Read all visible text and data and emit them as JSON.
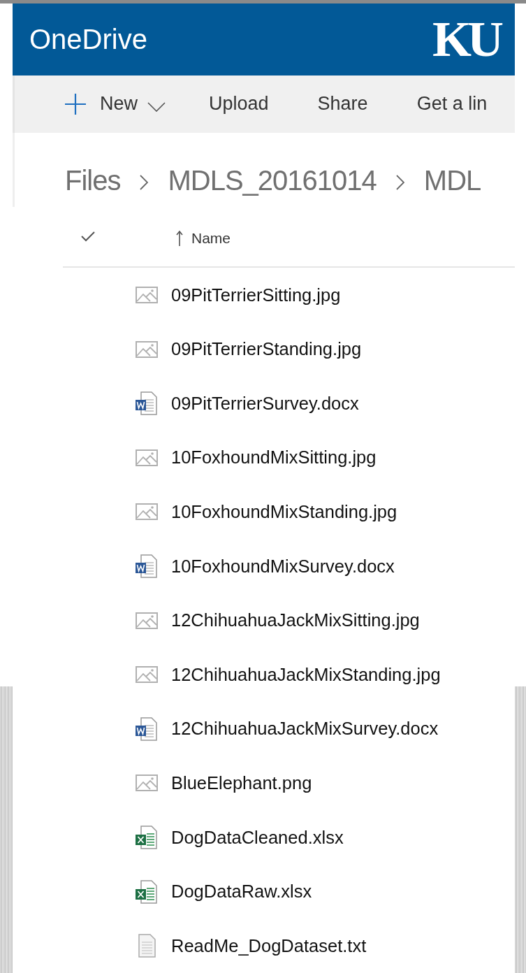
{
  "header": {
    "title": "OneDrive",
    "logo": "KU"
  },
  "toolbar": [
    {
      "kind": "new",
      "label": "New"
    },
    {
      "kind": "plain",
      "label": "Upload"
    },
    {
      "kind": "plain",
      "label": "Share"
    },
    {
      "kind": "plain",
      "label": "Get a lin"
    }
  ],
  "breadcrumb": [
    "Files",
    "MDLS_20161014",
    "MDL"
  ],
  "table": {
    "columns": [
      {
        "label": "Name",
        "sorted": true
      }
    ],
    "rows": [
      {
        "name": "09PitTerrierSitting.jpg",
        "kind": "image"
      },
      {
        "name": "09PitTerrierStanding.jpg",
        "kind": "image"
      },
      {
        "name": "09PitTerrierSurvey.docx",
        "kind": "word"
      },
      {
        "name": "10FoxhoundMixSitting.jpg",
        "kind": "image"
      },
      {
        "name": "10FoxhoundMixStanding.jpg",
        "kind": "image"
      },
      {
        "name": "10FoxhoundMixSurvey.docx",
        "kind": "word"
      },
      {
        "name": "12ChihuahuaJackMixSitting.jpg",
        "kind": "image"
      },
      {
        "name": "12ChihuahuaJackMixStanding.jpg",
        "kind": "image"
      },
      {
        "name": "12ChihuahuaJackMixSurvey.docx",
        "kind": "word"
      },
      {
        "name": "BlueElephant.png",
        "kind": "image"
      },
      {
        "name": "DogDataCleaned.xlsx",
        "kind": "excel"
      },
      {
        "name": "DogDataRaw.xlsx",
        "kind": "excel"
      },
      {
        "name": "ReadMe_DogDataset.txt",
        "kind": "text"
      }
    ]
  }
}
